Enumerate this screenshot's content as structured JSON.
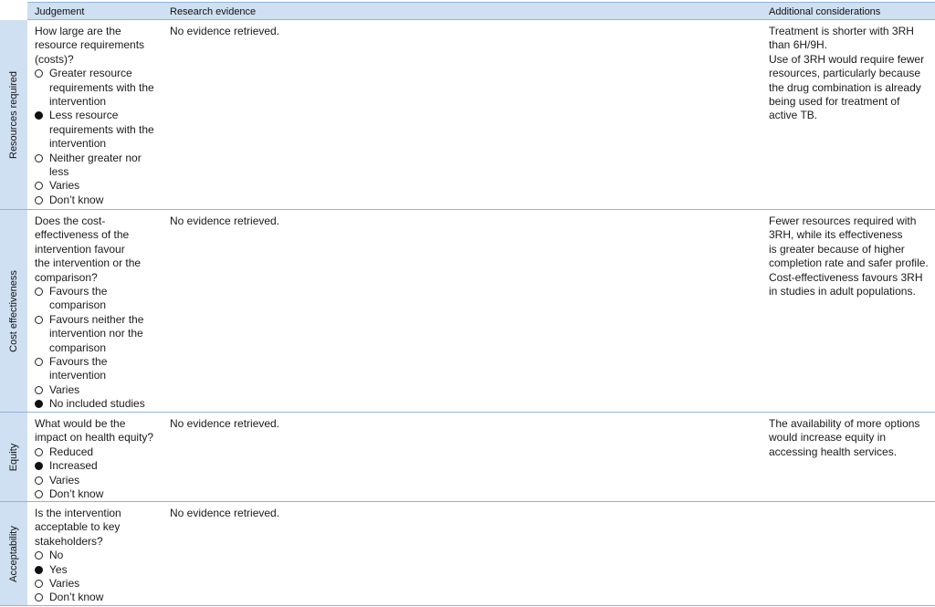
{
  "header": {
    "judgement": "Judgement",
    "research_evidence": "Research evidence",
    "additional_considerations": "Additional considerations"
  },
  "rows": [
    {
      "label": "Resources required",
      "question": "How large are the\nresource requirements\n(costs)?",
      "options": [
        {
          "label": "Greater resource\nrequirements with the\nintervention",
          "selected": false
        },
        {
          "label": "Less resource\nrequirements with the\nintervention",
          "selected": true
        },
        {
          "label": "Neither greater nor\nless",
          "selected": false
        },
        {
          "label": "Varies",
          "selected": false
        },
        {
          "label": "Don’t know",
          "selected": false
        }
      ],
      "evidence": "No evidence retrieved.",
      "considerations": "Treatment is shorter with 3RH\nthan 6H/9H.\nUse of 3RH would require fewer\nresources, particularly because\nthe drug combination is already\nbeing used for treatment of\nactive TB."
    },
    {
      "label": "Cost effectiveness",
      "question": "Does the cost-\neffectiveness of the\nintervention favour\nthe intervention or the\ncomparison?",
      "options": [
        {
          "label": "Favours the\ncomparison",
          "selected": false
        },
        {
          "label": "Favours neither the\nintervention nor the\ncomparison",
          "selected": false
        },
        {
          "label": "Favours the\nintervention",
          "selected": false
        },
        {
          "label": "Varies",
          "selected": false
        },
        {
          "label": "No included studies",
          "selected": true
        }
      ],
      "evidence": "No evidence retrieved.",
      "considerations": "Fewer resources required with\n3RH, while its effectiveness\nis greater because of higher\ncompletion rate and safer profile.\nCost-effectiveness favours 3RH\nin studies in adult populations."
    },
    {
      "label": "Equity",
      "question": "What would be the\nimpact on health equity?",
      "options": [
        {
          "label": "Reduced",
          "selected": false
        },
        {
          "label": "Increased",
          "selected": true
        },
        {
          "label": "Varies",
          "selected": false
        },
        {
          "label": "Don’t know",
          "selected": false
        }
      ],
      "evidence": "No evidence retrieved.",
      "considerations": "The availability of more options\nwould increase equity in\naccessing health services."
    },
    {
      "label": "Acceptability",
      "question": "Is the intervention\nacceptable to key\nstakeholders?",
      "options": [
        {
          "label": "No",
          "selected": false
        },
        {
          "label": "Yes",
          "selected": true
        },
        {
          "label": "Varies",
          "selected": false
        },
        {
          "label": "Don’t know",
          "selected": false
        }
      ],
      "evidence": "No evidence retrieved.",
      "considerations": ""
    }
  ]
}
